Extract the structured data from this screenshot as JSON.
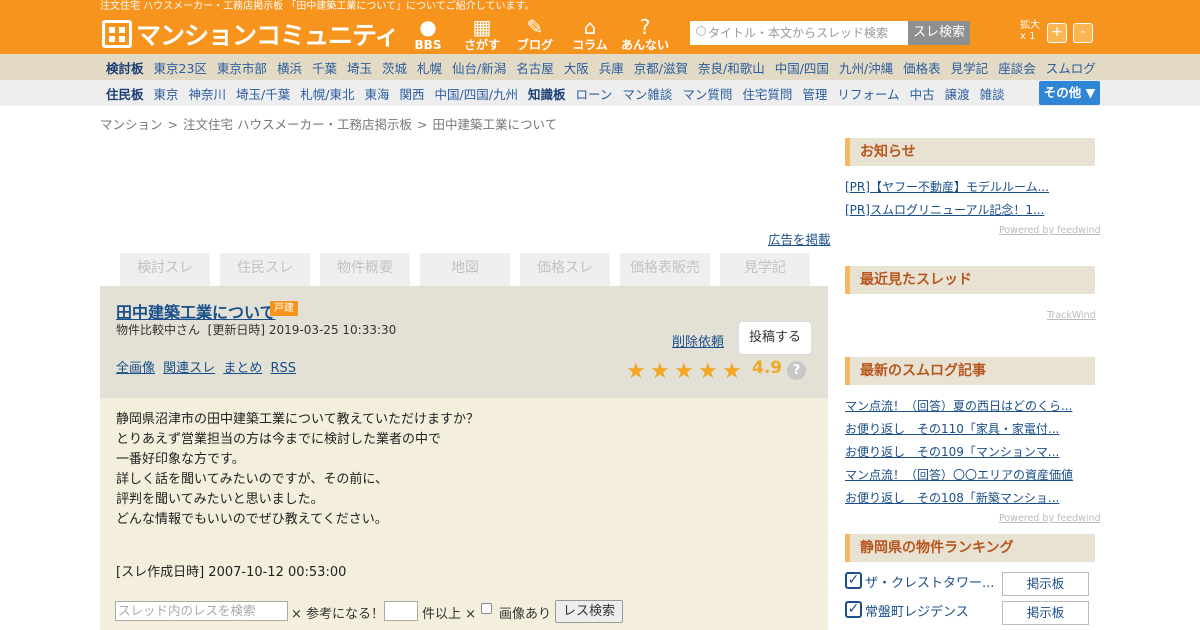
{
  "header": {
    "tagline": "注文住宅 ハウスメーカー・工務店掲示板 「田中建築工業について」についてご紹介しています。",
    "logo_text": "マンションコミュニティ",
    "nav": [
      "BBS",
      "さがす",
      "ブログ",
      "コラム",
      "あんない"
    ],
    "search_placeholder": "タイトル・本文からスレッド検索",
    "search_button": "スレ検索",
    "zoom_label": "拡大",
    "zoom_value": "x 1",
    "zoom_plus": "+",
    "zoom_minus": "-"
  },
  "bar1": {
    "title": "検討板",
    "items": [
      "東京23区",
      "東京市部",
      "横浜",
      "千葉",
      "埼玉",
      "茨城",
      "札幌",
      "仙台/新潟",
      "名古屋",
      "大阪",
      "兵庫",
      "京都/滋賀",
      "奈良/和歌山",
      "中国/四国",
      "九州/沖縄",
      "価格表",
      "見学記",
      "座談会",
      "スムログ"
    ]
  },
  "bar2": {
    "title": "住民板",
    "items": [
      "東京",
      "神奈川",
      "埼玉/千葉",
      "札幌/東北",
      "東海",
      "関西",
      "中国/四国/九州",
      "知識板",
      "ローン",
      "マン雑談",
      "マン質問",
      "住宅質問",
      "管理",
      "リフォーム",
      "中古",
      "譲渡",
      "雑談"
    ],
    "other": "その他 ▼"
  },
  "breadcrumb": [
    "マンション",
    "注文住宅 ハウスメーカー・工務店掲示板",
    "田中建築工業について"
  ],
  "ad_link": "広告を掲載",
  "tabs": [
    "検討スレ",
    "住民スレ",
    "物件概要",
    "地図",
    "価格スレ",
    "価格表販売",
    "見学記"
  ],
  "thread": {
    "title": "田中建築工業について",
    "badge": "戸建",
    "author": "物件比較中さん",
    "updated": "[更新日時] 2019-03-25 10:33:30",
    "links": [
      "全画像",
      "関連スレ",
      "まとめ",
      "RSS"
    ],
    "delete": "削除依頼",
    "post": "投稿する",
    "rating": "4.9",
    "stars": 5,
    "body": [
      "静岡県沼津市の田中建築工業について教えていただけますか？",
      "とりあえず営業担当の方は今までに検討した業者の中で",
      "一番好印象な方です。",
      "詳しく話を聞いてみたいのですが、その前に、",
      "評判を聞いてみたいと思いました。",
      "どんな情報でもいいのでぜひ教えてください。"
    ],
    "created_label": "[スレ作成日時]",
    "created": "2007-10-12 00:53:00"
  },
  "res_search": {
    "placeholder": "スレッド内のレスを検索",
    "useful": "× 参考になる！",
    "over": "件以上 ×",
    "images": "画像あり",
    "button": "レス検索"
  },
  "sidebar": {
    "notice_title": "お知らせ",
    "notices": [
      "[PR]【ヤフー不動産】モデルルーム...",
      "[PR]スムログリニューアル記念！1..."
    ],
    "powered": "Powered by feedwind",
    "recent_title": "最近見たスレッド",
    "trackwind": "TrackWind",
    "smolog_title": "最新のスムログ記事",
    "smolog": [
      "マン点流！（回答）夏の西日はどのくら...",
      "お便り返し　その110「家具・家電付...",
      "お便り返し　その109「マンションマ...",
      "マン点流！（回答）〇〇エリアの資産価値",
      "お便り返し　その108「新築マンショ..."
    ],
    "powered2": "Powered by feedwind",
    "ranking_title": "静岡県の物件ランキング",
    "ranking": [
      "ザ・クレストタワー...",
      "常盤町レジデンス"
    ],
    "board_btn": "掲示板"
  }
}
